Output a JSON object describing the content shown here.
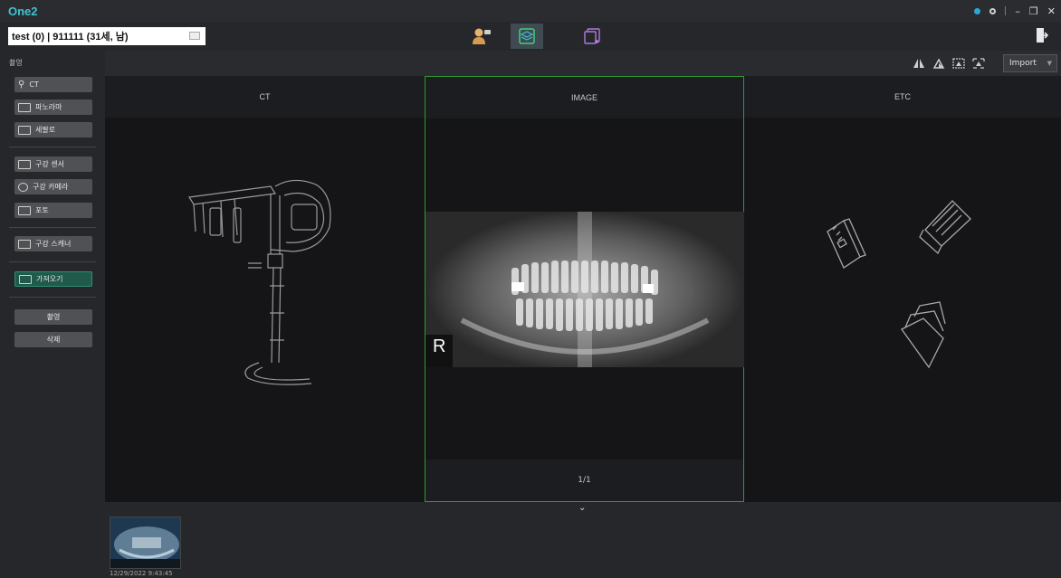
{
  "app": {
    "title": "One2"
  },
  "patient": {
    "info": "test  (0) | 911111 (31세, 남)"
  },
  "sidebar": {
    "section_label": "촬영",
    "buttons": [
      {
        "label": "CT",
        "icon": "ct-scanner-icon"
      },
      {
        "label": "파노라마",
        "icon": "panorama-icon"
      },
      {
        "label": "세팔로",
        "icon": "cephalo-icon"
      },
      {
        "label": "구강 센서",
        "icon": "intraoral-sensor-icon"
      },
      {
        "label": "구강 카메라",
        "icon": "intraoral-camera-icon"
      },
      {
        "label": "포토",
        "icon": "photo-icon"
      },
      {
        "label": "구강 스캐너",
        "icon": "intraoral-scanner-icon"
      },
      {
        "label": "가져오기",
        "icon": "import-icon"
      }
    ],
    "actions": [
      {
        "label": "촬영"
      },
      {
        "label": "삭제"
      }
    ]
  },
  "toolbar": {
    "import_label": "Import"
  },
  "panels": {
    "ct": {
      "title": "CT"
    },
    "image": {
      "title": "IMAGE",
      "page": "1/1",
      "marker": "R"
    },
    "etc": {
      "title": "ETC"
    }
  },
  "thumbnails": [
    {
      "date": "12/29/2022 9:43:45"
    }
  ],
  "colors": {
    "accent": "#3fc3d3",
    "selected_border": "#2f9a2f",
    "import_button": "#1f5a4a"
  }
}
